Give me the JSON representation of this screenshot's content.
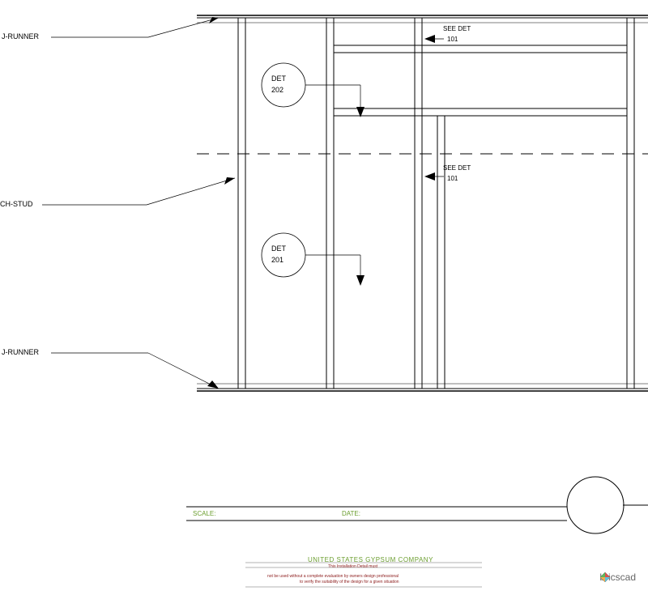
{
  "labels": {
    "j_runner_top": "J-RUNNER",
    "j_runner_bottom": "J-RUNNER",
    "ch_stud": "CH-STUD",
    "det_202_label": "DET",
    "det_202_num": "202",
    "det_201_label": "DET",
    "det_201_num": "201",
    "see_det_top": "SEE DET",
    "see_det_top_num": "101",
    "see_det_bottom": "SEE DET",
    "see_det_bottom_num": "101"
  },
  "title_block": {
    "scale": "SCALE:",
    "date": "DATE:"
  },
  "footer": {
    "company": "UNITED STATES GYPSUM COMPANY",
    "line1": "This Installation Detail must",
    "line2": "not be used without a complete evaluation by owners design professional",
    "line3": "to verify the suitability of the design for a given situation"
  },
  "watermark": "bricscad"
}
